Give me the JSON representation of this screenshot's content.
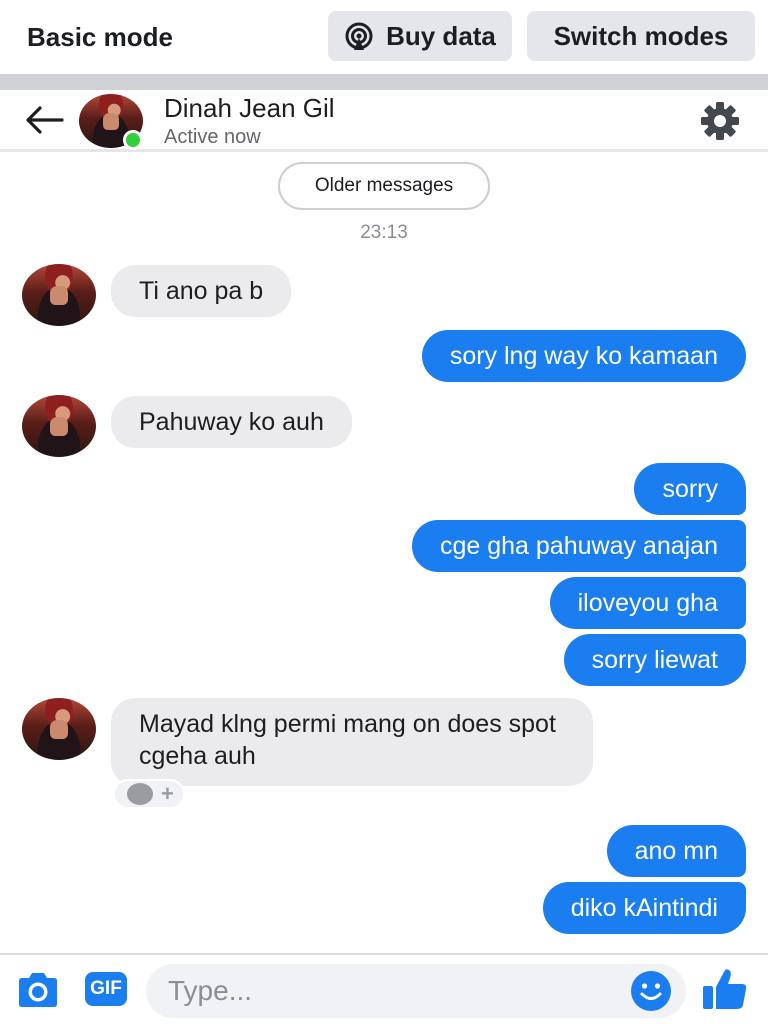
{
  "topbar": {
    "mode_title": "Basic mode",
    "buy_data_label": "Buy data",
    "switch_modes_label": "Switch modes"
  },
  "header": {
    "contact_name": "Dinah Jean Gil",
    "status": "Active now"
  },
  "thread": {
    "older_messages_label": "Older messages",
    "timestamp": "23:13",
    "messages": [
      {
        "from": "them",
        "text": "Ti ano pa b"
      },
      {
        "from": "me",
        "text": "sory lng way ko kamaan"
      },
      {
        "from": "them",
        "text": "Pahuway ko auh"
      },
      {
        "from": "me",
        "text": "sorry"
      },
      {
        "from": "me",
        "text": "cge gha pahuway anajan"
      },
      {
        "from": "me",
        "text": "iloveyou gha"
      },
      {
        "from": "me",
        "text": "sorry liewat"
      },
      {
        "from": "them",
        "text": "Mayad klng permi mang on does spot cgeha auh"
      },
      {
        "from": "me",
        "text": "ano mn"
      },
      {
        "from": "me",
        "text": "diko kAintindi"
      }
    ],
    "reaction_plus": "+"
  },
  "composer": {
    "gif_label": "GIF",
    "placeholder": "Type..."
  },
  "icons": {
    "back": "back-arrow-icon",
    "settings": "gear-icon",
    "buy_data": "data-signal-icon",
    "camera": "camera-icon",
    "emoji": "emoji-icon",
    "like": "thumbs-up-icon"
  },
  "colors": {
    "accent": "#1a7ef1",
    "incoming_bubble": "#ebebed",
    "online": "#31d03b"
  }
}
